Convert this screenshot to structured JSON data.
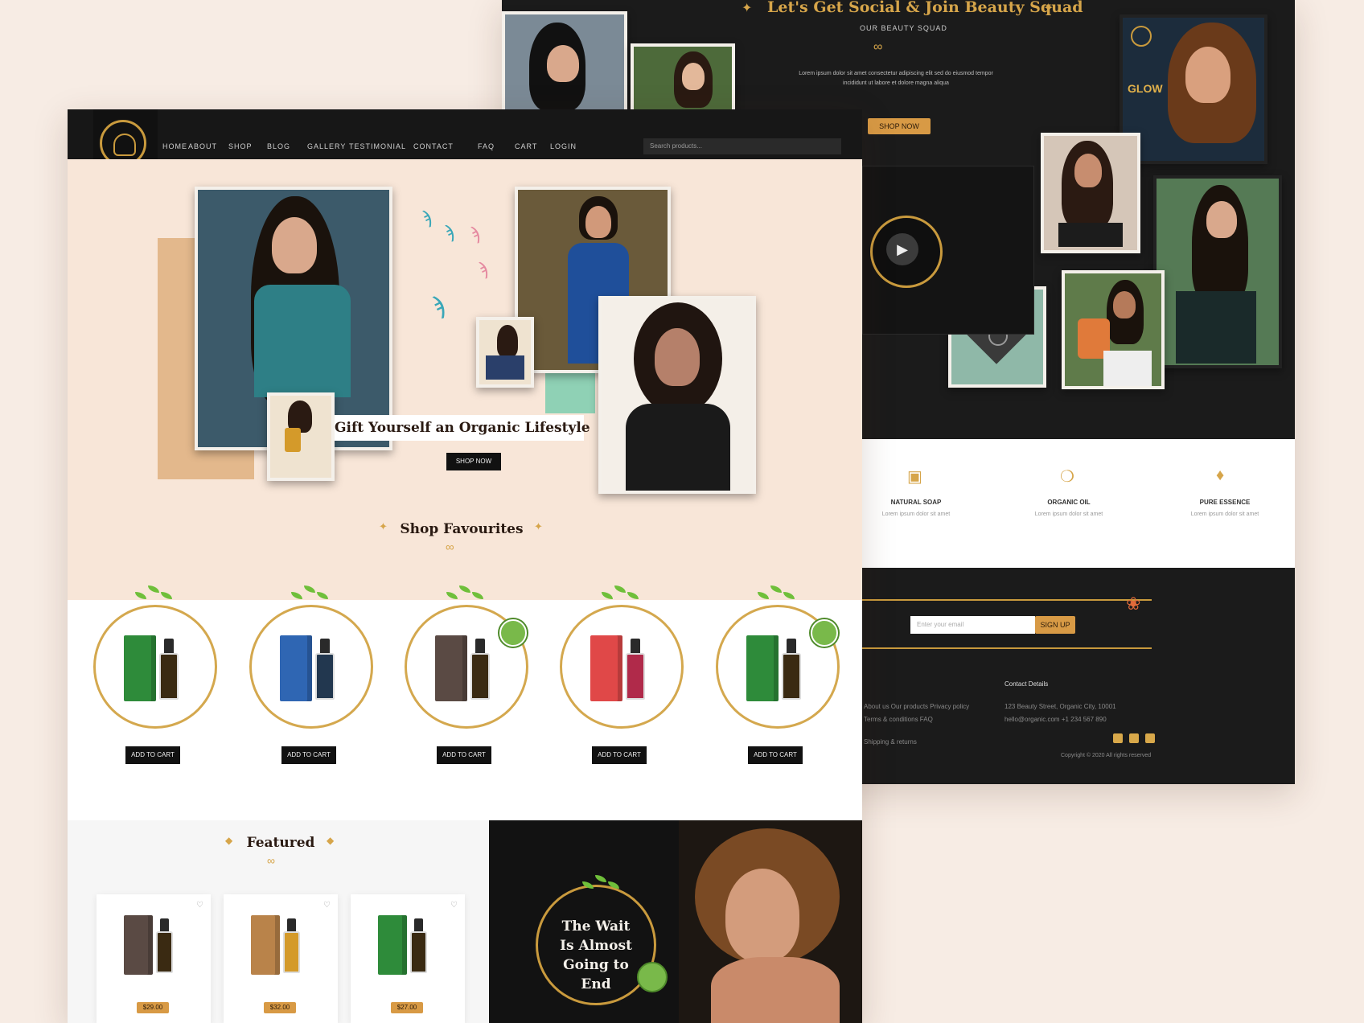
{
  "back": {
    "hero_title": "Let's Get Social & Join Beauty Squad",
    "hero_subtitle": "OUR BEAUTY SQUAD",
    "hero_body_line1": "Lorem ipsum dolor sit amet consectetur adipiscing elit sed do eiusmod tempor",
    "hero_body_line2": "incididunt ut labore et dolore magna aliqua",
    "hero_button": "SHOP NOW",
    "features": [
      {
        "icon": "soap-icon",
        "title": "NATURAL SOAP",
        "text": "Lorem ipsum dolor sit amet"
      },
      {
        "icon": "leaf-icon",
        "title": "ORGANIC OIL",
        "text": "Lorem ipsum dolor sit amet"
      },
      {
        "icon": "drop-icon",
        "title": "PURE ESSENCE",
        "text": "Lorem ipsum dolor sit amet"
      }
    ],
    "newsletter_placeholder": "Enter your email",
    "newsletter_button": "SIGN UP",
    "footer_heading": "Contact Details",
    "footer_links": [
      "About us  Our products  Privacy policy",
      "Terms & conditions  FAQ",
      "Shipping & returns"
    ],
    "footer_contact": [
      "123 Beauty Street, Organic City, 10001",
      "hello@organic.com  +1 234 567 890"
    ],
    "copyright": "Copyright © 2020 All rights reserved",
    "social_icons": [
      "twitter-icon",
      "instagram-icon",
      "youtube-icon"
    ]
  },
  "front": {
    "nav_items": [
      "HOME",
      "ABOUT",
      "SHOP",
      "BLOG",
      "GALLERY",
      "TESTIMONIAL",
      "CONTACT",
      "FAQ",
      "CART",
      "LOGIN"
    ],
    "search_placeholder": "Search products...",
    "hero_title": "Gift Yourself an Organic Lifestyle",
    "hero_button": "SHOP NOW",
    "favorites_title": "Shop Favourites",
    "products": [
      {
        "color": "#2e8b3a",
        "bottle": "#3a2a12",
        "button": "ADD TO CART",
        "badge": false
      },
      {
        "color": "#2f66b3",
        "bottle": "#22374f",
        "button": "ADD TO CART",
        "badge": false
      },
      {
        "color": "#5a4a44",
        "bottle": "#3a2a12",
        "button": "ADD TO CART",
        "badge": true
      },
      {
        "color": "#e04848",
        "bottle": "#b02a4a",
        "button": "ADD TO CART",
        "badge": false
      },
      {
        "color": "#2e8b3a",
        "bottle": "#3a2a12",
        "button": "ADD TO CART",
        "badge": true
      }
    ],
    "arrivals_title": "Featured",
    "arrivals": [
      {
        "color": "#5a4a44",
        "bottle": "#3a2a12",
        "price": "$29.00"
      },
      {
        "color": "#b9834a",
        "bottle": "#d49a2a",
        "price": "$32.00"
      },
      {
        "color": "#2e8b3a",
        "bottle": "#3a2a12",
        "price": "$27.00"
      }
    ],
    "promo_text": "The Wait Is Almost Going to End"
  },
  "colors": {
    "gold": "#d6a54a",
    "dark": "#1b1b1b",
    "peach": "#f8e6d8",
    "mint": "#8fd1b5"
  }
}
